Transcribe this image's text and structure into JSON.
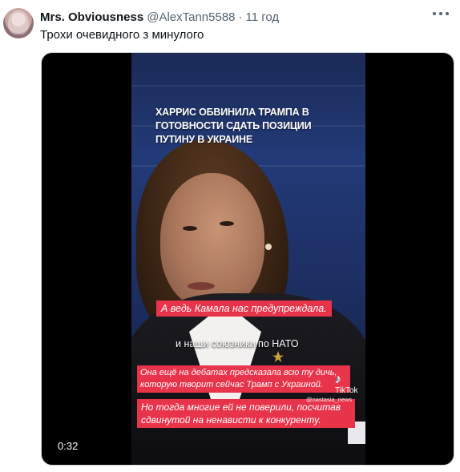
{
  "tweet": {
    "name": "Mrs. Obviousness",
    "handle": "@AlexTann5588",
    "separator": "·",
    "time": "11 год",
    "text": "Трохи очевидного з минулого"
  },
  "video": {
    "headline": "ХАРРИС ОБВИНИЛА ТРАМПА В ГОТОВНОСТИ СДАТЬ ПОЗИЦИИ ПУТИНУ В УКРАИНЕ",
    "caption1": "А ведь Камала нас предупреждала.",
    "caption2": "и наши союзники по НАТО",
    "caption3": "Она ещё на дебатах предсказала всю ту дичь, которую творит сейчас Трамп с Украиной.",
    "caption4": "Но тогда многие ей не поверили, посчитав сдвинутой на ненависти к конкуренту.",
    "tiktok_label": "TikTok",
    "tiktok_user": "@nastasia_news",
    "duration": "0:32"
  }
}
